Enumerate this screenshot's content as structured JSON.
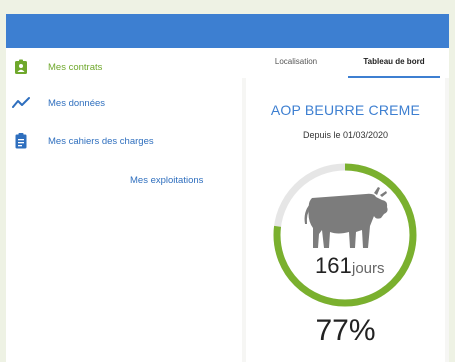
{
  "sidebar": {
    "items": [
      {
        "label": "Mes contrats",
        "icon": "contract-badge-icon",
        "active": true
      },
      {
        "label": "Mes données",
        "icon": "trend-line-icon",
        "active": false
      },
      {
        "label": "Mes cahiers des charges",
        "icon": "clipboard-icon",
        "active": false
      }
    ],
    "exploitations_link": "Mes exploitations"
  },
  "tabs": [
    {
      "label": "Localisation",
      "active": false
    },
    {
      "label": "Tableau de bord",
      "active": true
    }
  ],
  "card": {
    "title": "AOP BEURRE CREME",
    "since": "Depuis le 01/03/2020",
    "days_value": "161",
    "days_unit": "jours",
    "percent_text": "77%",
    "progress": 0.77,
    "icon": "cow-icon"
  },
  "colors": {
    "header": "#3d7fd1",
    "accent_green": "#7ab02e",
    "link_blue": "#2f6fbe",
    "gauge_track": "#e6e6e6",
    "cow": "#7c7c7c"
  }
}
